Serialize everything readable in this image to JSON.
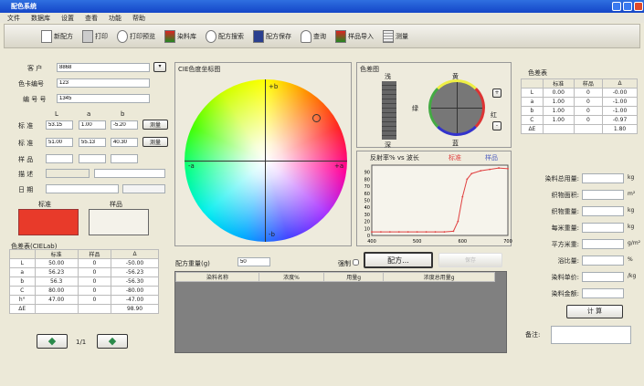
{
  "window": {
    "title": "配色系统"
  },
  "menu": [
    "文件",
    "数据库",
    "设置",
    "查看",
    "功能",
    "帮助"
  ],
  "toolbar": [
    "新配方",
    "打印",
    "打印预览",
    "染料库",
    "配方搜索",
    "配方保存",
    "查询",
    "样品导入",
    "测量"
  ],
  "left": {
    "customer_label": "客 户",
    "customer_value": "8868",
    "card_label": "色卡编号",
    "card_value": "123",
    "number_label": "编 号 号",
    "number_value": "1345",
    "col_headers": [
      "L",
      "a",
      "b"
    ],
    "std_label": "标 准",
    "std_values": [
      "53.15",
      "1.00",
      "-5.20"
    ],
    "std_button": "测量",
    "std2_label": "标 准",
    "std2_values": [
      "51.00",
      "55.13",
      "40.30"
    ],
    "std2_button": "测量",
    "sample_label": "样 品",
    "desc_label": "描 述",
    "date_label": "日 期",
    "swatch_std_label": "标准",
    "swatch_sample_label": "样品",
    "std_color": "#e83a2a"
  },
  "diff_table": {
    "title": "色差表(CIELab)",
    "headers": [
      "",
      "标准",
      "样品",
      "Δ"
    ],
    "rows": [
      [
        "L",
        "50.00",
        "0",
        "-50.00"
      ],
      [
        "a",
        "56.23",
        "0",
        "-56.23"
      ],
      [
        "b",
        "56.3",
        "0",
        "-56.30"
      ],
      [
        "C",
        "80.00",
        "0",
        "-80.00"
      ],
      [
        "h°",
        "47.00",
        "0",
        "-47.00"
      ],
      [
        "ΔE",
        "",
        "",
        "98.90"
      ]
    ],
    "prev_icon": "arrow-left-icon",
    "next_icon": "arrow-right-icon",
    "nav_label": "1/1"
  },
  "colorwheel": {
    "title": "CIE色度坐标图",
    "axis_top": "+b",
    "axis_bottom": "-b",
    "axis_left": "-a",
    "axis_right": "+a"
  },
  "colorbar": {
    "title": "色差图",
    "top": "浅",
    "bottom": "深",
    "ball_top": "黄",
    "ball_bottom": "蓝",
    "ball_left": "绿",
    "ball_right": "红",
    "plus": "+",
    "minus": "-"
  },
  "chart_data": {
    "type": "line",
    "title": "反射率% vs 波长",
    "xlim": [
      400,
      700
    ],
    "ylim": [
      0,
      100
    ],
    "xticks": [
      "400",
      "500",
      "600",
      "700"
    ],
    "yticks": [
      "0",
      "10",
      "20",
      "30",
      "40",
      "50",
      "60",
      "70",
      "80",
      "90"
    ],
    "series": [
      {
        "name": "标准",
        "color": "#e04040",
        "x": [
          400,
          420,
          440,
          460,
          480,
          500,
          520,
          540,
          560,
          580,
          590,
          600,
          610,
          620,
          640,
          660,
          680,
          700
        ],
        "y": [
          5,
          5,
          5,
          5,
          5,
          5,
          5,
          5,
          5,
          6,
          20,
          55,
          80,
          88,
          92,
          94,
          96,
          95
        ]
      },
      {
        "name": "样品",
        "color": "#5060c0",
        "x": [],
        "y": []
      }
    ]
  },
  "right_table": {
    "title": "色差表",
    "headers": [
      "",
      "标准",
      "样品",
      "Δ"
    ],
    "rows": [
      [
        "L",
        "0.00",
        "0",
        "-0.00"
      ],
      [
        "a",
        "1.00",
        "0",
        "-1.00"
      ],
      [
        "b",
        "1.00",
        "0",
        "-1.00"
      ],
      [
        "C",
        "1.00",
        "0",
        "-0.97"
      ],
      [
        "ΔE",
        "",
        "",
        "1.80"
      ]
    ]
  },
  "fields": [
    {
      "label": "染料总用量:",
      "unit": "kg"
    },
    {
      "label": "织物面积:",
      "unit": "m²"
    },
    {
      "label": "织物重量:",
      "unit": "kg"
    },
    {
      "label": "每米重量:",
      "unit": "kg"
    },
    {
      "label": "平方米重:",
      "unit": "g/m²"
    },
    {
      "label": "浴比量:",
      "unit": "%"
    },
    {
      "label": "染料单价:",
      "unit": "/kg"
    },
    {
      "label": "染料金额:",
      "unit": ""
    }
  ],
  "calc_button": "计 算",
  "remark_label": "备注:",
  "bottom": {
    "weight_label": "配方重量(g)",
    "weight_value": "50",
    "force_label": "强制",
    "recipe_button": "配方...",
    "save_button": "保存",
    "headers": [
      "染料名称",
      "浓度%",
      "用量g",
      "浓度总用量g"
    ]
  }
}
